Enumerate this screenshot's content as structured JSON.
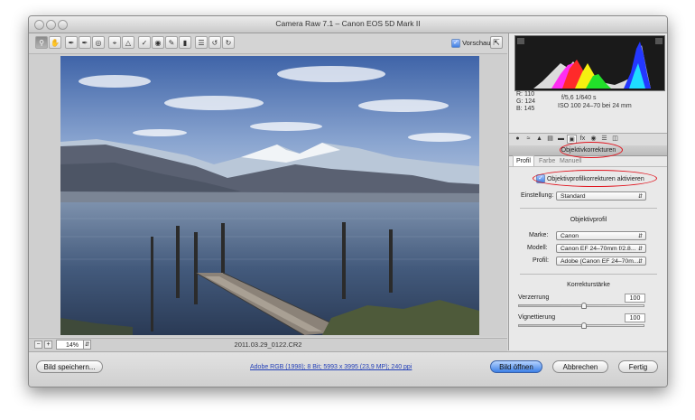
{
  "window": {
    "title": "Camera Raw 7.1 – Canon EOS 5D Mark II"
  },
  "toolbar": {
    "tools": [
      "zoom-tool",
      "hand-tool",
      "white-balance-tool",
      "color-sampler-tool",
      "target-adjustment-tool",
      "crop-tool",
      "straighten-tool",
      "spot-removal-tool",
      "red-eye-tool",
      "adjustment-brush-tool",
      "graduated-filter-tool",
      "preferences-tool",
      "rotate-left-tool",
      "rotate-right-tool"
    ],
    "preview_label": "Vorschau",
    "preview_checked": true
  },
  "status": {
    "zoom": "14%",
    "filename": "2011.03.29_0122.CR2"
  },
  "readout": {
    "r_label": "R:",
    "r_value": "110",
    "g_label": "G:",
    "g_value": "124",
    "b_label": "B:",
    "b_value": "145",
    "exposure": "f/5,6   1/640 s",
    "iso_lens": "ISO 100   24–70 bei 24 mm"
  },
  "panel": {
    "title": "Objektivkorrekturen",
    "subtabs": [
      "Profil",
      "Farbe",
      "Manuell"
    ],
    "enable_label": "Objektivprofilkorrekturen aktivieren",
    "enable_checked": true,
    "setting_label": "Einstellung:",
    "setting_value": "Standard",
    "profile_section": "Objektivprofil",
    "make_label": "Marke:",
    "make_value": "Canon",
    "model_label": "Modell:",
    "model_value": "Canon EF 24–70mm f/2.8...",
    "profile_label": "Profil:",
    "profile_value": "Adobe (Canon EF 24–70m...",
    "strength_section": "Korrekturstärke",
    "distortion_label": "Verzerrung",
    "distortion_value": "100",
    "vignetting_label": "Vignettierung",
    "vignetting_value": "100"
  },
  "footer": {
    "save_label": "Bild speichern...",
    "workflow_link": "Adobe RGB (1998); 8 Bit; 5993 x 3995 (23,9 MP); 240 ppi",
    "open_label": "Bild öffnen",
    "cancel_label": "Abbrechen",
    "done_label": "Fertig"
  },
  "colors": {
    "accent": "#3d80e6",
    "highlight_ring": "#e0141e"
  }
}
